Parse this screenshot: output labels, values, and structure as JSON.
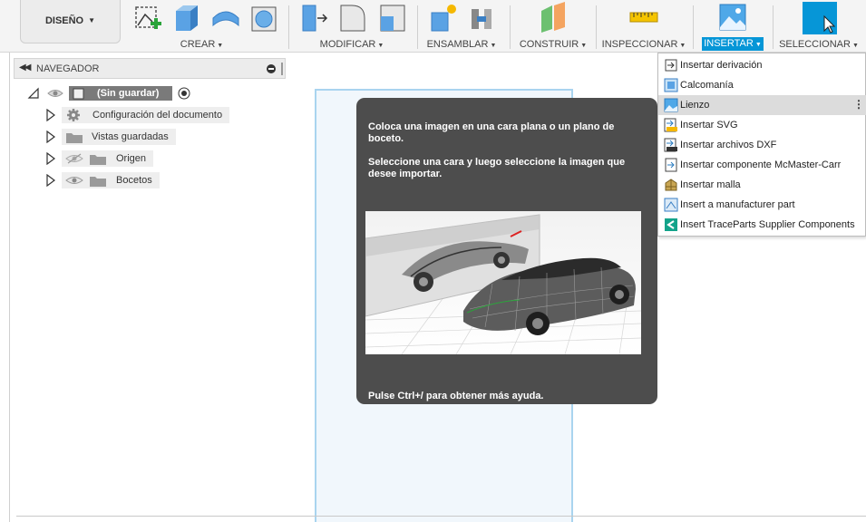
{
  "toolbar": {
    "workspace_label": "DISEÑO",
    "groups": [
      {
        "label": "CREAR"
      },
      {
        "label": "MODIFICAR"
      },
      {
        "label": "ENSAMBLAR"
      },
      {
        "label": "CONSTRUIR"
      },
      {
        "label": "INSPECCIONAR"
      },
      {
        "label": "INSERTAR"
      },
      {
        "label": "SELECCIONAR"
      }
    ],
    "active_color": "#0696d7"
  },
  "navigator": {
    "title": "NAVEGADOR",
    "root_label": "(Sin guardar)",
    "items": [
      {
        "label": "Configuración del documento",
        "icon": "gear-icon"
      },
      {
        "label": "Vistas guardadas",
        "icon": "folder-icon"
      },
      {
        "label": "Origen",
        "icon": "folder-icon"
      },
      {
        "label": "Bocetos",
        "icon": "folder-icon"
      }
    ]
  },
  "tooltip": {
    "paragraph1": "Coloca una imagen en una cara plana o un plano de boceto.",
    "paragraph2": "Seleccione una cara y luego seleccione la imagen que desee importar.",
    "help": "Pulse Ctrl+/ para obtener más ayuda."
  },
  "insert_menu": {
    "items": [
      {
        "label": "Insertar derivación",
        "icon": "derive-icon"
      },
      {
        "label": "Calcomanía",
        "icon": "decal-icon"
      },
      {
        "label": "Lienzo",
        "icon": "canvas-icon",
        "highlighted": true
      },
      {
        "label": "Insertar SVG",
        "icon": "svg-icon"
      },
      {
        "label": "Insertar archivos DXF",
        "icon": "dxf-icon"
      },
      {
        "label": "Insertar componente McMaster-Carr",
        "icon": "mcmaster-icon"
      },
      {
        "label": "Insertar malla",
        "icon": "mesh-icon"
      },
      {
        "label": "Insert a manufacturer part",
        "icon": "manufacturer-part-icon"
      },
      {
        "label": "Insert TraceParts Supplier Components",
        "icon": "traceparts-icon"
      }
    ]
  }
}
